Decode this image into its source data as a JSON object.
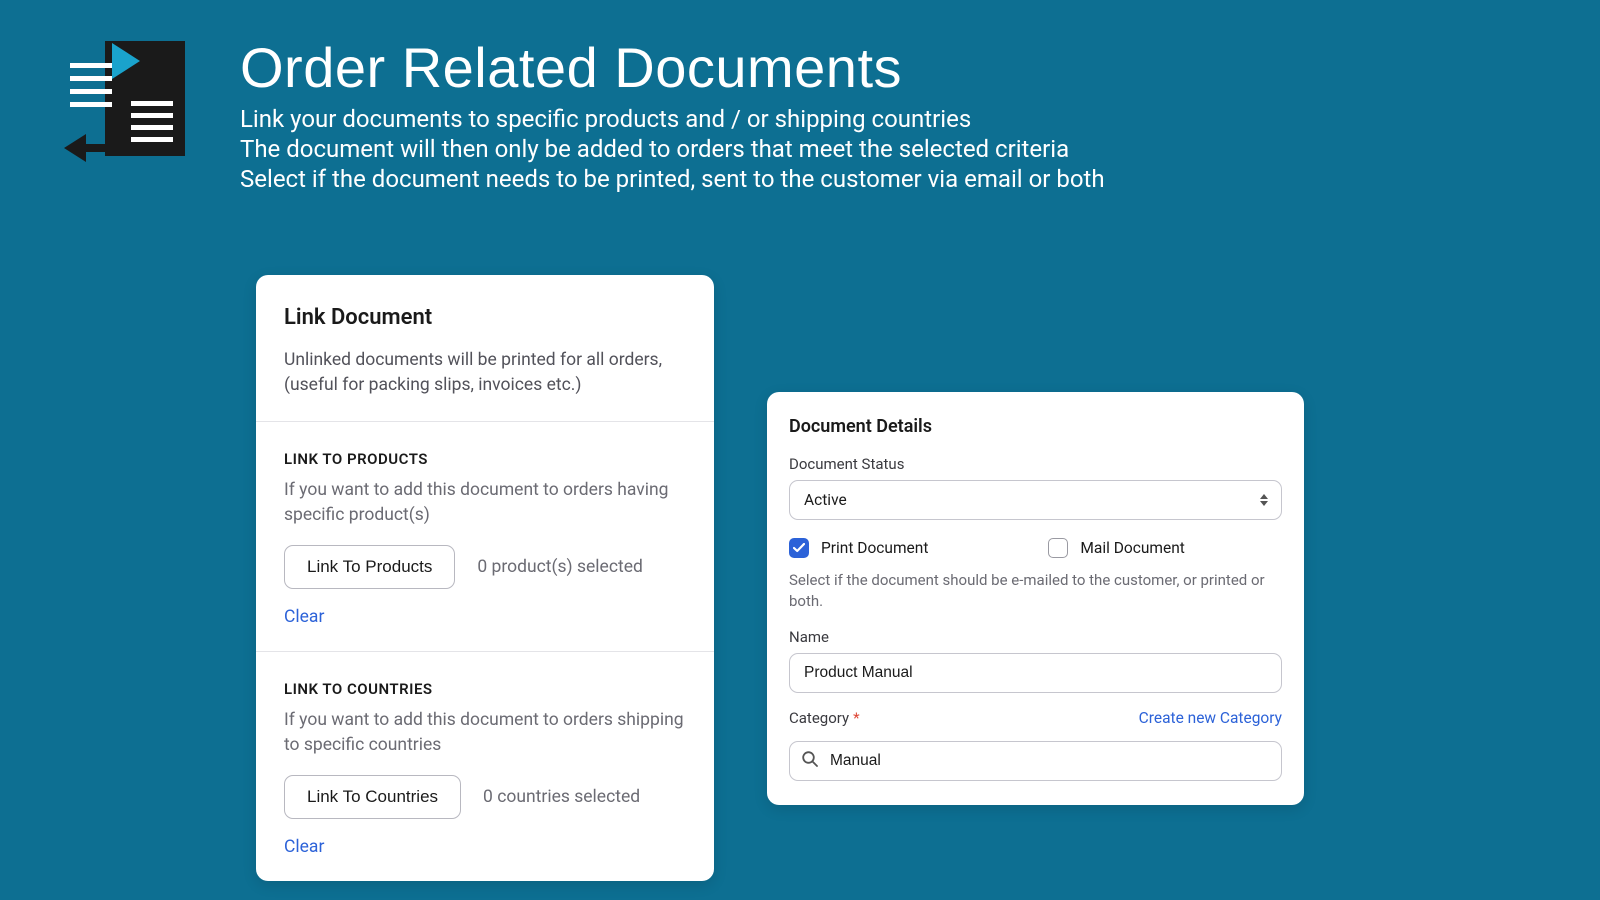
{
  "header": {
    "title": "Order Related Documents",
    "line1": "Link your documents to specific products and / or shipping countries",
    "line2": "The document will then only be added to orders that meet the selected criteria",
    "line3": "Select if the document needs to be printed, sent to the customer via email or both"
  },
  "link_panel": {
    "title": "Link Document",
    "description": "Unlinked documents will be printed for all orders, (useful for packing slips, invoices etc.)",
    "products": {
      "heading": "LINK TO PRODUCTS",
      "description": "If you want to add this document to orders having specific product(s)",
      "button": "Link To Products",
      "count": "0 product(s) selected",
      "clear": "Clear"
    },
    "countries": {
      "heading": "LINK TO COUNTRIES",
      "description": "If you want to add this document to orders shipping to specific countries",
      "button": "Link To Countries",
      "count": "0 countries selected",
      "clear": "Clear"
    }
  },
  "details_panel": {
    "title": "Document Details",
    "status_label": "Document Status",
    "status_value": "Active",
    "print_label": "Print Document",
    "print_checked": true,
    "mail_label": "Mail Document",
    "mail_checked": false,
    "help": "Select if the document should be e-mailed to the customer, or printed or both.",
    "name_label": "Name",
    "name_value": "Product Manual",
    "category_label": "Category",
    "required_mark": "*",
    "create_category": "Create new Category",
    "category_value": "Manual"
  }
}
